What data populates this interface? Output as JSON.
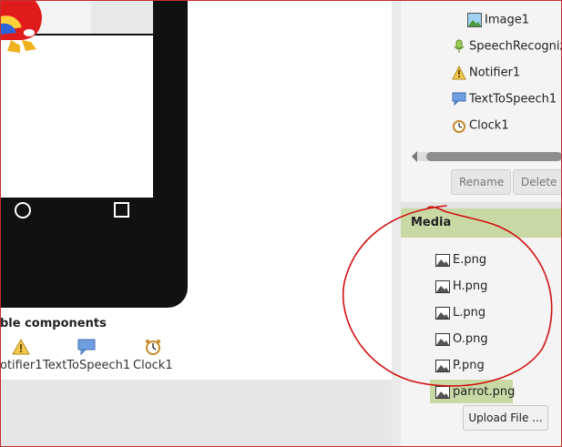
{
  "components_tree": {
    "items": [
      {
        "label": "Image1",
        "icon": "image-icon"
      },
      {
        "label": "SpeechRecognize",
        "icon": "microphone-icon"
      },
      {
        "label": "Notifier1",
        "icon": "warning-icon"
      },
      {
        "label": "TextToSpeech1",
        "icon": "speech-bubble-icon"
      },
      {
        "label": "Clock1",
        "icon": "clock-icon"
      }
    ],
    "rename_label": "Rename",
    "delete_label": "Delete"
  },
  "media": {
    "title": "Media",
    "files": [
      "E.png",
      "H.png",
      "L.png",
      "O.png",
      "P.png",
      "parrot.png"
    ],
    "selected": "parrot.png",
    "upload_label": "Upload File ..."
  },
  "non_visible": {
    "title": "ble components",
    "items": [
      "otifier1",
      "TextToSpeech1",
      "Clock1"
    ]
  },
  "colors": {
    "media_header": "#c9d9a6",
    "annotation": "#d01010",
    "phone_frame": "#111111"
  }
}
